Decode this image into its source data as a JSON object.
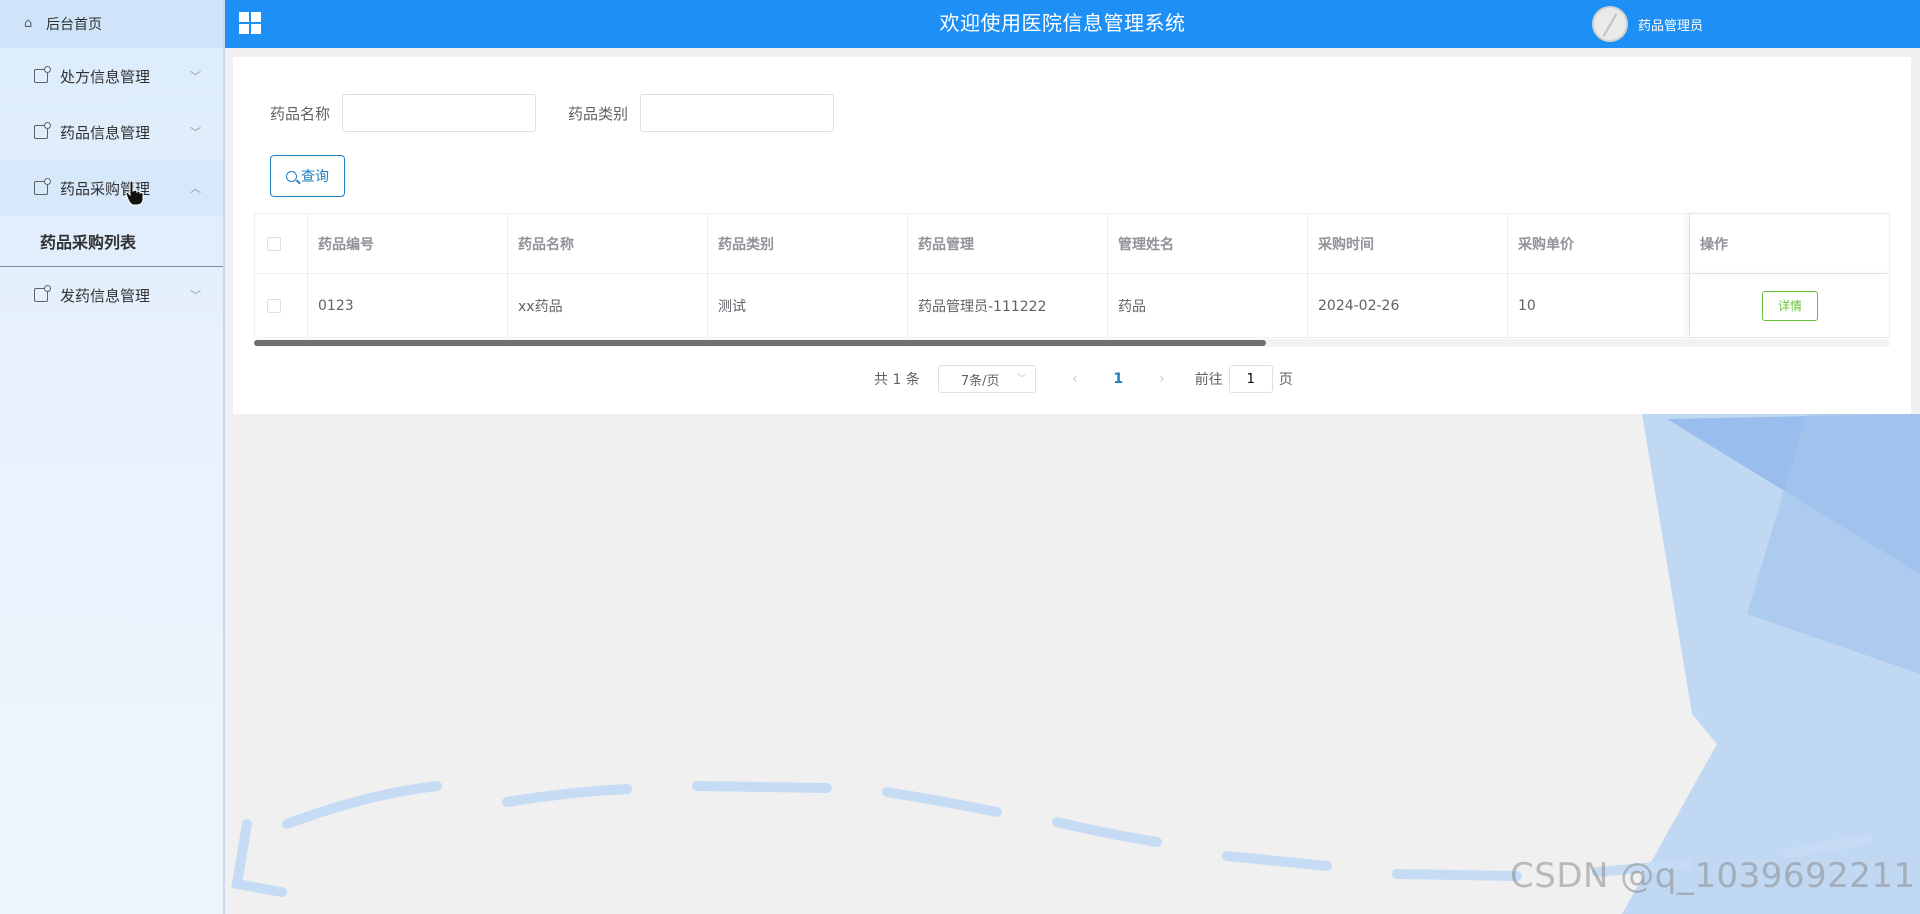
{
  "sidebar": {
    "home_label": "后台首页",
    "items": [
      {
        "label": "处方信息管理"
      },
      {
        "label": "药品信息管理"
      },
      {
        "label": "药品采购管理"
      },
      {
        "label": "发药信息管理"
      }
    ],
    "submenu_label": "药品采购列表"
  },
  "header": {
    "title": "欢迎使用医院信息管理系统",
    "user_name": "药品管理员"
  },
  "search": {
    "name_label": "药品名称",
    "name_value": "",
    "category_label": "药品类别",
    "category_value": "",
    "query_button": "查询"
  },
  "table": {
    "columns": [
      "药品编号",
      "药品名称",
      "药品类别",
      "药品管理",
      "管理姓名",
      "采购时间",
      "采购单价",
      "操作"
    ],
    "rows": [
      {
        "cells": [
          "0123",
          "xx药品",
          "测试",
          "药品管理员-111222",
          "药品",
          "2024-02-26",
          "10"
        ],
        "action": "详情"
      }
    ]
  },
  "pagination": {
    "total_text": "共 1 条",
    "page_size": "7条/页",
    "current_page": "1",
    "goto_prefix": "前往",
    "goto_value": "1",
    "goto_suffix": "页"
  },
  "watermark": "CSDN @q_1039692211",
  "colors": {
    "header_bg": "#1e90f5",
    "primary_text": "#1e7fc0",
    "detail_button": "#67c23a"
  },
  "icons": [
    "home-icon",
    "menu-icon",
    "chevron-down-icon",
    "chevron-up-icon",
    "grid-icon",
    "search-icon",
    "avatar"
  ]
}
